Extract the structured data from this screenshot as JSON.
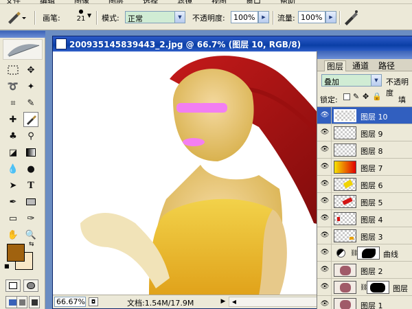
{
  "menu": {
    "items": [
      "文件",
      "编辑",
      "图像",
      "图层",
      "选择",
      "滤镜",
      "视图",
      "窗口",
      "帮助"
    ]
  },
  "options_bar": {
    "brush_label": "画笔:",
    "brush_size": "21",
    "mode_label": "模式:",
    "mode_value": "正常",
    "opacity_label": "不透明度:",
    "opacity_value": "100%",
    "flow_label": "流量:",
    "flow_value": "100%"
  },
  "document": {
    "title": "200935145839443_2.jpg @ 66.7% (图层 10, RGB/8)",
    "zoom": "66.67%",
    "doc_info": "文档:1.54M/17.9M"
  },
  "colors": {
    "foreground": "#a0620f",
    "background": "#f7e7c7",
    "title_blue": "#0a3fa6",
    "selected_layer": "#315fbf"
  },
  "layers_panel": {
    "tabs": [
      {
        "label": "图层"
      },
      {
        "label": "通道"
      },
      {
        "label": "路径"
      }
    ],
    "blend_mode": "叠加",
    "opacity_label": "不透明度",
    "lock_label": "锁定:",
    "fill_label": "填充",
    "layers": [
      {
        "name": "图层 10"
      },
      {
        "name": "图层 9"
      },
      {
        "name": "图层 8"
      },
      {
        "name": "图层 7"
      },
      {
        "name": "图层 6"
      },
      {
        "name": "图层 5"
      },
      {
        "name": "图层 4"
      },
      {
        "name": "图层 3"
      },
      {
        "name": "曲线"
      },
      {
        "name": "图层 2"
      },
      {
        "name": "图层"
      },
      {
        "name": "图层 1"
      }
    ]
  },
  "tool_icons": [
    "marquee-tool-icon",
    "move-tool-icon",
    "lasso-tool-icon",
    "magic-wand-tool-icon",
    "crop-tool-icon",
    "slice-tool-icon",
    "healing-brush-tool-icon",
    "brush-tool-icon",
    "clone-stamp-tool-icon",
    "history-brush-tool-icon",
    "eraser-tool-icon",
    "gradient-tool-icon",
    "blur-tool-icon",
    "dodge-tool-icon",
    "path-select-tool-icon",
    "type-tool-icon",
    "pen-tool-icon",
    "shape-tool-icon",
    "notes-tool-icon",
    "eyedropper-tool-icon",
    "hand-tool-icon",
    "zoom-tool-icon"
  ]
}
